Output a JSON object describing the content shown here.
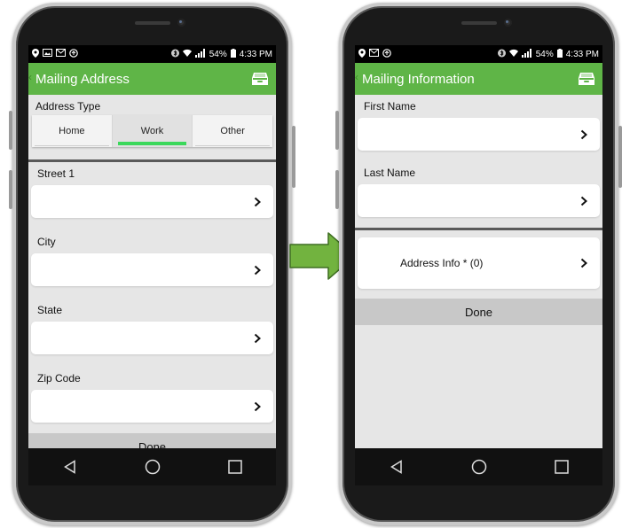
{
  "status_bar": {
    "battery": "54%",
    "time": "4:33 PM"
  },
  "left_screen": {
    "title": "Mailing Address",
    "address_type_label": "Address Type",
    "address_types": [
      {
        "label": "Home",
        "selected": false
      },
      {
        "label": "Work",
        "selected": true
      },
      {
        "label": "Other",
        "selected": false
      }
    ],
    "fields": [
      {
        "label": "Street 1",
        "value": ""
      },
      {
        "label": "City",
        "value": ""
      },
      {
        "label": "State",
        "value": ""
      },
      {
        "label": "Zip Code",
        "value": ""
      }
    ],
    "done_label": "Done"
  },
  "right_screen": {
    "title": "Mailing Information",
    "fields": [
      {
        "label": "First Name",
        "value": ""
      },
      {
        "label": "Last Name",
        "value": ""
      }
    ],
    "address_info_label": "Address Info * (0)",
    "done_label": "Done"
  },
  "colors": {
    "app_bar": "#5fb547",
    "tab_indicator": "#3bd85b",
    "arrow": "#72b33f"
  }
}
